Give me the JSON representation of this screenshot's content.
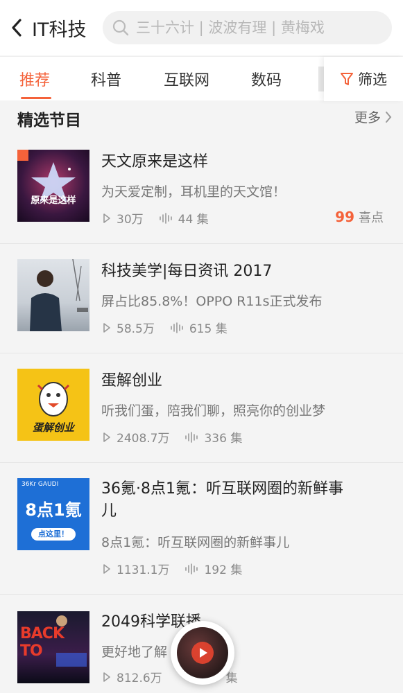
{
  "header": {
    "title": "IT科技",
    "search_placeholder": "三十六计 | 波波有理 | 黄梅戏"
  },
  "tabs": {
    "items": [
      {
        "label": "推荐",
        "active": true
      },
      {
        "label": "科普",
        "active": false
      },
      {
        "label": "互联网",
        "active": false
      },
      {
        "label": "数码",
        "active": false
      }
    ],
    "filter_label": "筛选"
  },
  "section": {
    "title": "精选节目",
    "more_label": "更多"
  },
  "programs": [
    {
      "title": "天文原来是这样",
      "desc": "为天爱定制，耳机里的天文馆！",
      "plays": "30万",
      "episodes": "44 集",
      "likes_num": "99",
      "likes_label": "喜点",
      "cover_text": "原来是这样"
    },
    {
      "title": "科技美学|每日资讯 2017",
      "desc": "屏占比85.8%！OPPO R11s正式发布",
      "plays": "58.5万",
      "episodes": "615 集",
      "cover_text": ""
    },
    {
      "title": "蛋解创业",
      "desc": "听我们蛋，陪我们聊，照亮你的创业梦",
      "plays": "2408.7万",
      "episodes": "336 集",
      "cover_text": "蛋解创业"
    },
    {
      "title": "36氪·8点1氪：听互联网圈的新鲜事儿",
      "desc": "8点1氪：听互联网圈的新鲜事儿",
      "plays": "1131.1万",
      "episodes": "192 集",
      "cover_text": "8点1氪",
      "cover_sub": "点这里！",
      "cover_brand": "36Kr GAUDI"
    },
    {
      "title": "2049科学联播",
      "desc": "更好地了解",
      "plays": "812.6万",
      "episodes": "集",
      "cover_text": "BACK TO"
    }
  ],
  "colors": {
    "accent": "#f4623a",
    "background": "#f4f4f4"
  }
}
